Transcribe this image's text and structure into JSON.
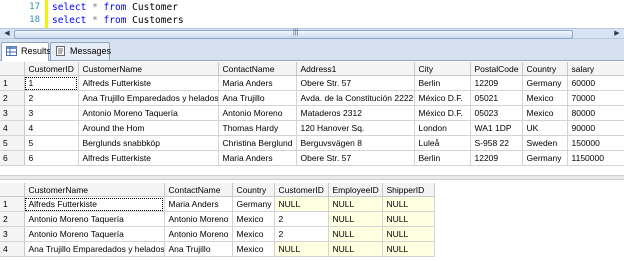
{
  "editor": {
    "lines": [
      {
        "num": "17",
        "kw1": "select",
        "op": "*",
        "kw2": "from",
        "table": "Customer"
      },
      {
        "num": "18",
        "kw1": "select",
        "op": "*",
        "kw2": "from",
        "table": "Customers"
      }
    ]
  },
  "scroll": {
    "left_arrow": "◀",
    "right_arrow": "▶",
    "grip": "|||"
  },
  "tabs": [
    {
      "label": "Results",
      "icon": "grid-icon"
    },
    {
      "label": "Messages",
      "icon": "messages-icon"
    }
  ],
  "grid1": {
    "columns": [
      "CustomerID",
      "CustomerName",
      "ContactName",
      "Address1",
      "City",
      "PostalCode",
      "Country",
      "salary"
    ],
    "rows": [
      [
        "1",
        "1",
        "Alfreds Futterkiste",
        "Maria Anders",
        "Obere Str. 57",
        "Berlin",
        "12209",
        "Germany",
        "60000"
      ],
      [
        "2",
        "2",
        "Ana Trujillo Emparedados y helados",
        "Ana Trujillo",
        "Avda. de la Constitución 2222",
        "México D.F.",
        "05021",
        "Mexico",
        "70000"
      ],
      [
        "3",
        "3",
        "Antonio Moreno Taquería",
        "Antonio Moreno",
        "Mataderos 2312",
        "México D.F.",
        "05023",
        "Mexico",
        "80000"
      ],
      [
        "4",
        "4",
        "Around the Hom",
        "Thomas Hardy",
        "120 Hanover Sq.",
        "London",
        "WA1 1DP",
        "UK",
        "90000"
      ],
      [
        "5",
        "5",
        "Berglunds snabbköp",
        "Christina Berglund",
        "Berguvsvägen 8",
        "Luleå",
        "S-958 22",
        "Sweden",
        "150000"
      ],
      [
        "6",
        "6",
        "Alfreds Futterkiste",
        "Maria Anders",
        "Obere Str. 57",
        "Berlin",
        "12209",
        "Germany",
        "1150000"
      ]
    ]
  },
  "grid2": {
    "columns": [
      "CustomerName",
      "ContactName",
      "Country",
      "CustomerID",
      "EmployeeID",
      "ShipperID"
    ],
    "rows": [
      [
        "1",
        "Alfreds Futterkiste",
        "Maria Anders",
        "Germany",
        "NULL",
        "NULL",
        "NULL"
      ],
      [
        "2",
        "Antonio Moreno Taquería",
        "Antonio Moreno",
        "Mexico",
        "2",
        "NULL",
        "NULL"
      ],
      [
        "3",
        "Antonio Moreno Taquería",
        "Antonio Moreno",
        "Mexico",
        "2",
        "NULL",
        "NULL"
      ],
      [
        "4",
        "Ana Trujillo Emparedados y helados",
        "Ana Trujillo",
        "Mexico",
        "NULL",
        "NULL",
        "NULL"
      ]
    ]
  },
  "colors": {
    "keyword": "#0000ff",
    "line_number": "#2b91af",
    "change_bar": "#f2f204",
    "null_cell": "#ffffe1",
    "tab_strip": "#d6e1f0"
  }
}
